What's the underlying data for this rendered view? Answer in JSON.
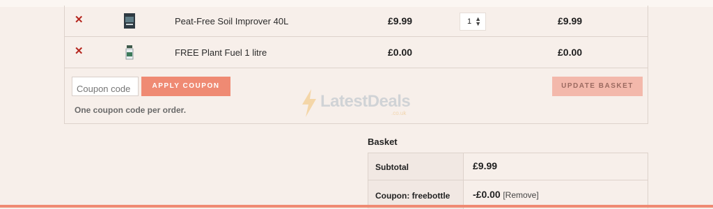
{
  "cart": {
    "items": [
      {
        "name": "Peat-Free Soil Improver 40L",
        "price": "£9.99",
        "quantity": "1",
        "subtotal": "£9.99",
        "remove_icon": "close-x-icon"
      },
      {
        "name": "FREE Plant Fuel 1 litre",
        "price": "£0.00",
        "subtotal": "£0.00",
        "remove_icon": "close-x-icon"
      }
    ],
    "coupon": {
      "placeholder": "Coupon code",
      "apply_label": "APPLY COUPON",
      "note": "One coupon code per order."
    },
    "update_label": "UPDATE BASKET"
  },
  "watermark": {
    "text": "LatestDeals",
    "sub": ".co.uk"
  },
  "totals": {
    "title": "Basket",
    "subtotal_label": "Subtotal",
    "subtotal_value": "£9.99",
    "coupon_label": "Coupon: freebottle",
    "coupon_value": "-£0.00",
    "remove_label": "[Remove]"
  },
  "colors": {
    "accent": "#ef8a73",
    "accent_light": "#f3b8ab",
    "background": "#f7efea",
    "remove": "#b5271f"
  }
}
